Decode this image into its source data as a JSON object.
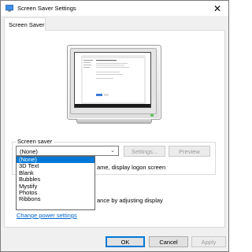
{
  "window": {
    "title": "Screen Saver Settings",
    "close_glyph": "✕"
  },
  "tabs": [
    {
      "label": "Screen Saver"
    }
  ],
  "group": {
    "label": "Screen saver"
  },
  "screensaver_combo": {
    "value": "(None)",
    "arrow_glyph": "⌄",
    "options": [
      "(None)",
      "3D Text",
      "Blank",
      "Bubbles",
      "Mystify",
      "Photos",
      "Ribbons"
    ],
    "selected_index": 0
  },
  "buttons": {
    "settings": "Settings...",
    "preview": "Preview",
    "ok": "OK",
    "cancel": "Cancel",
    "apply": "Apply"
  },
  "partial_text": {
    "logon": "ame, display logon screen",
    "power": "ance by adjusting display"
  },
  "link": {
    "change_power": "Change power settings"
  },
  "colors": {
    "accent": "#0078d7",
    "link": "#0066cc"
  }
}
